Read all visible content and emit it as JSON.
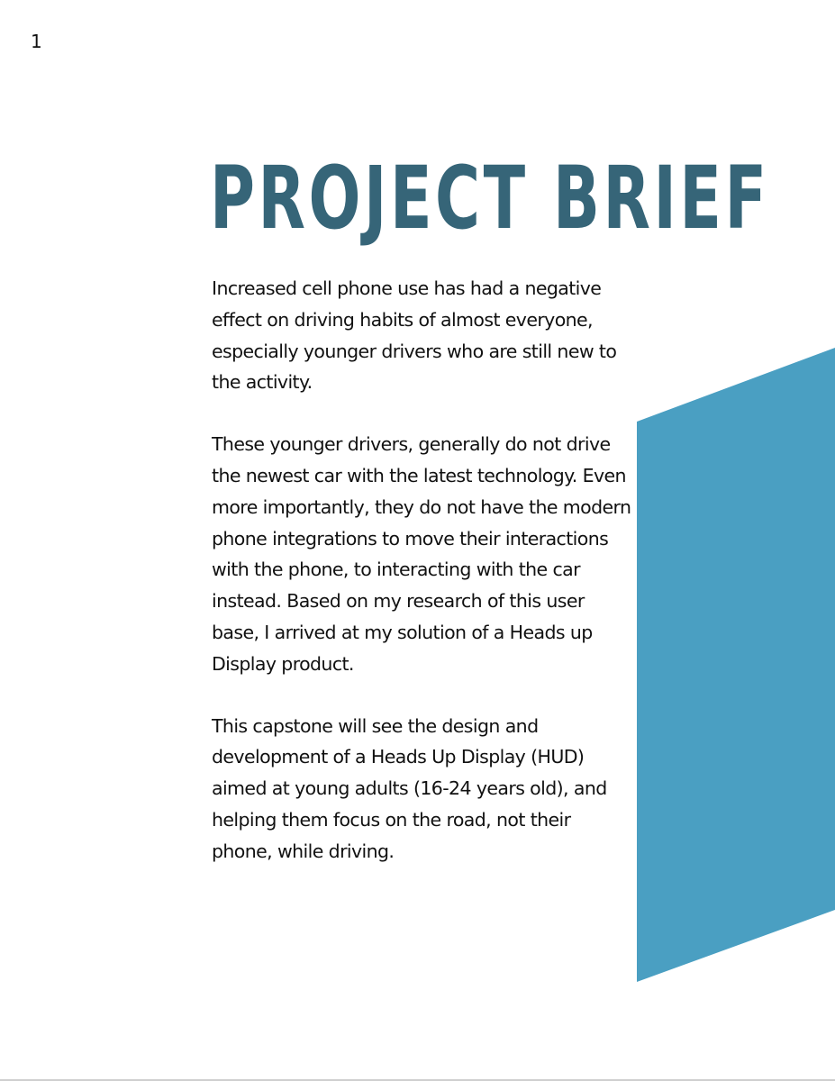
{
  "page": {
    "number": "1",
    "title": "PROJECT BRIEF",
    "paragraphs": [
      "Increased cell phone use has had a negative effect on driving habits of almost everyone, especially younger drivers who are still new to the activity.",
      "These younger drivers, generally do not drive the newest car with the latest technology. Even more importantly, they do not have the modern phone integrations to move their interactions with the phone, to interacting with the car instead. Based on my research of this user base, I arrived at my solution of a Heads up Display product.",
      "This capstone will see the design and development of a Heads Up Display (HUD) aimed at young adults (16-24 years old), and helping them focus on the road, not their phone, while driving."
    ]
  },
  "colors": {
    "title": "#366578",
    "accent_shape": "#4a9fc2",
    "body_text": "#111111"
  }
}
